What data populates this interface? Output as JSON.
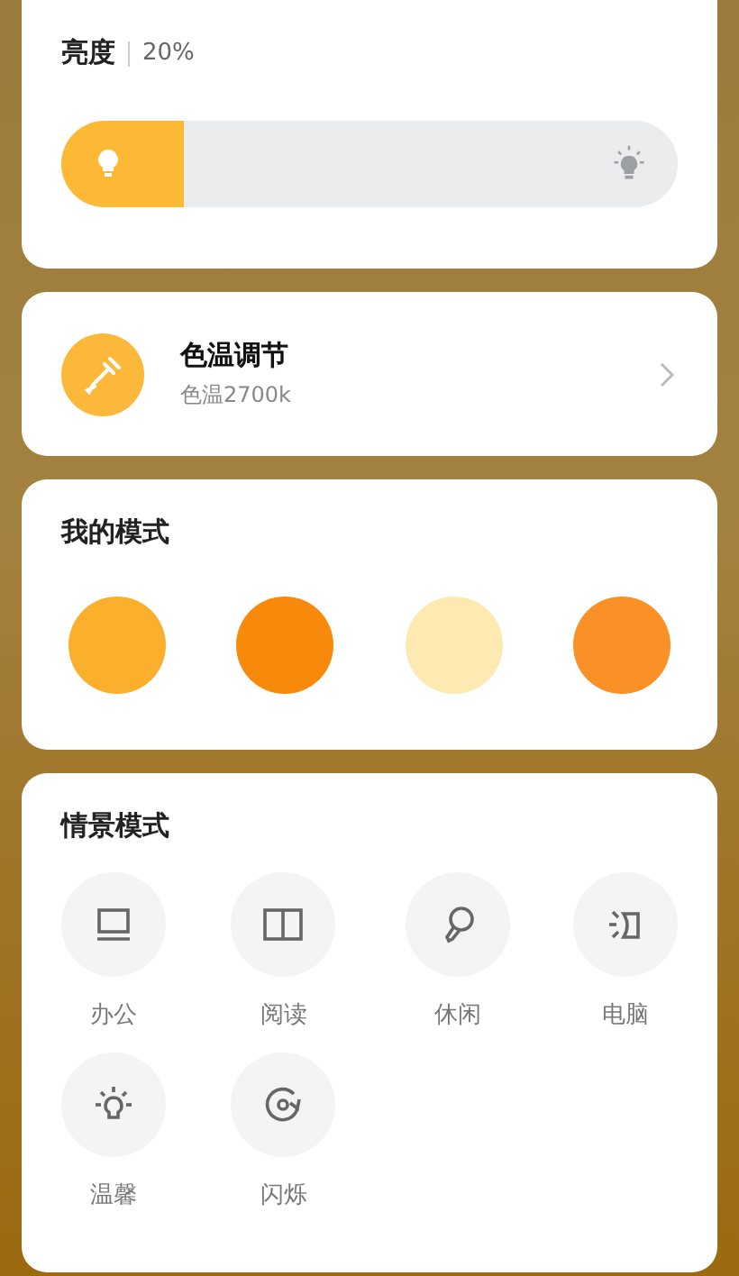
{
  "brightness": {
    "title": "亮度",
    "value": "20%",
    "level": 0.2
  },
  "color_temperature": {
    "title": "色温调节",
    "subtitle": "色温2700k"
  },
  "my_modes": {
    "title": "我的模式",
    "modes": [
      {
        "color": "#fbb02d"
      },
      {
        "color": "#f78a0b"
      },
      {
        "color": "#fdeab2"
      },
      {
        "color": "#f99126"
      }
    ]
  },
  "scene_modes": {
    "title": "情景模式",
    "items": [
      {
        "label": "办公",
        "kind": "laptop"
      },
      {
        "label": "阅读",
        "kind": "book"
      },
      {
        "label": "休闲",
        "kind": "microphone"
      },
      {
        "label": "电脑",
        "kind": "lamp"
      },
      {
        "label": "温馨",
        "kind": "bulb"
      },
      {
        "label": "闪烁",
        "kind": "cycle"
      }
    ]
  }
}
